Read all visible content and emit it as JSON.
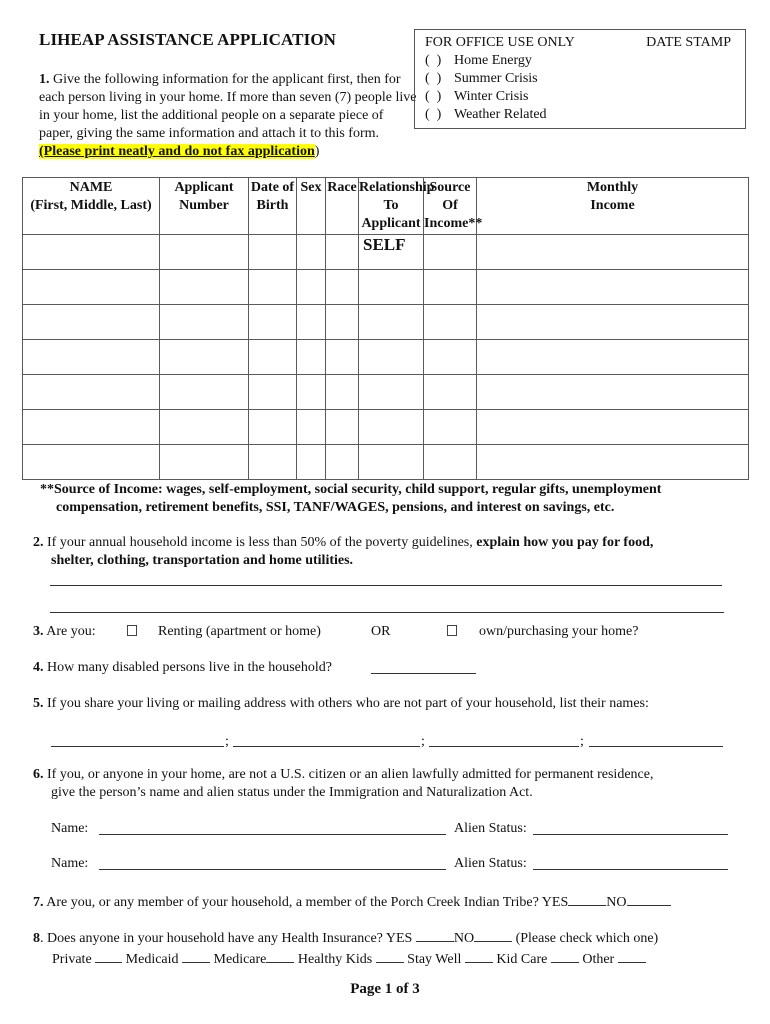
{
  "form": {
    "title": "LIHEAP ASSISTANCE APPLICATION",
    "page_label": "Page 1 of 3"
  },
  "office_use": {
    "heading": "FOR OFFICE USE ONLY",
    "date_stamp": "DATE STAMP",
    "items": [
      {
        "mark": "(  )",
        "label": "Home Energy"
      },
      {
        "mark": "(  )",
        "label": "Summer Crisis"
      },
      {
        "mark": "(  )",
        "label": "Winter Crisis"
      },
      {
        "mark": "(  )",
        "label": "Weather Related"
      }
    ]
  },
  "q1": {
    "number": "1.",
    "text": " Give the following information for the applicant first, then for each person living in your home.  If more than seven (7) people live in your home, list the additional people on a separate piece of paper, giving the same information and attach it to this form.  ",
    "highlight": "(Please print neatly and do not fax application",
    "close": ")",
    "highlight_color": "#ffff00"
  },
  "household_table": {
    "columns": [
      {
        "line1": "NAME",
        "line2": "(First, Middle, Last)",
        "line3": ""
      },
      {
        "line1": "Applicant",
        "line2": "Number",
        "line3": ""
      },
      {
        "line1": "Date of",
        "line2": "Birth",
        "line3": ""
      },
      {
        "line1": "Sex",
        "line2": "",
        "line3": ""
      },
      {
        "line1": "Race",
        "line2": "",
        "line3": ""
      },
      {
        "line1": "Relationship",
        "line2": "To",
        "line3": "Applicant"
      },
      {
        "line1": "Source",
        "line2": "Of",
        "line3": "Income**"
      },
      {
        "line1": "Monthly",
        "line2": "Income",
        "line3": ""
      }
    ],
    "rows": [
      [
        "",
        "",
        "",
        "",
        "",
        "SELF",
        "",
        ""
      ],
      [
        "",
        "",
        "",
        "",
        "",
        "",
        "",
        ""
      ],
      [
        "",
        "",
        "",
        "",
        "",
        "",
        "",
        ""
      ],
      [
        "",
        "",
        "",
        "",
        "",
        "",
        "",
        ""
      ],
      [
        "",
        "",
        "",
        "",
        "",
        "",
        "",
        ""
      ],
      [
        "",
        "",
        "",
        "",
        "",
        "",
        "",
        ""
      ],
      [
        "",
        "",
        "",
        "",
        "",
        "",
        "",
        ""
      ]
    ]
  },
  "footnote": {
    "line1": "**Source of Income: wages, self-employment, social security, child support, regular gifts, unemployment",
    "line2": "compensation, retirement benefits, SSI, TANF/WAGES, pensions, and interest on savings, etc."
  },
  "q2": {
    "number": "2.",
    "text": " If your annual household income is less than 50% of the poverty guidelines, ",
    "bold": "explain how you pay for food,",
    "bold2": "shelter, clothing, transportation and home utilities.",
    "answer_lines": [
      "",
      ""
    ]
  },
  "q3": {
    "number": "3.",
    "text": " Are you:",
    "option1": "Renting (apartment or home)",
    "or": "OR",
    "option2": "own/purchasing your home?",
    "option1_checked": false,
    "option2_checked": false
  },
  "q4": {
    "number": "4.",
    "text": " How many disabled persons live in the household?",
    "answer": ""
  },
  "q5": {
    "number": "5.",
    "text": " If you share your living or mailing address with others who are not part of your household, list their names:",
    "separator": ";",
    "names": [
      "",
      "",
      "",
      ""
    ]
  },
  "q6": {
    "number": "6.",
    "text": " If you, or anyone in your home, are not a U.S. citizen or an alien lawfully admitted for permanent residence,",
    "text2": "give the person’s name and alien status under the Immigration and Naturalization Act.",
    "name_label": "Name:",
    "status_label": "Alien Status:",
    "entries": [
      {
        "name": "",
        "status": ""
      },
      {
        "name": "",
        "status": ""
      }
    ]
  },
  "q7": {
    "number": "7.",
    "text": " Are you, or any member of your household, a member of the Porch Creek Indian Tribe? YES",
    "no_label": "NO",
    "yes_value": "",
    "no_value": ""
  },
  "q8": {
    "number": "8",
    "text": ". Does anyone in your household have any Health Insurance?  YES",
    "no_label": "NO",
    "note": "(Please check which one)",
    "options": [
      "Private",
      "Medicaid",
      "Medicare",
      "Healthy Kids",
      "Stay Well",
      "Kid Care",
      "Other"
    ]
  }
}
